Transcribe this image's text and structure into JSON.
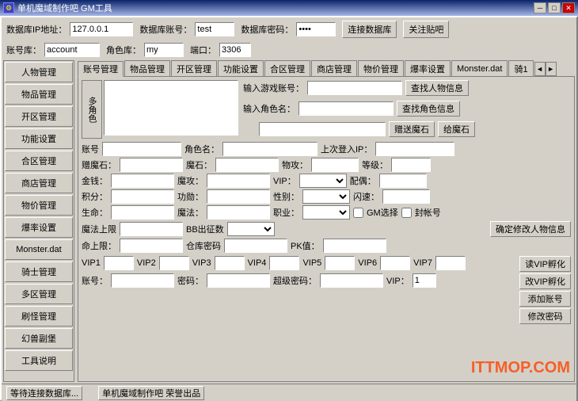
{
  "titleBar": {
    "icon": "⚙",
    "title": "单机魔域制作吧 GM工具",
    "minBtn": "─",
    "maxBtn": "□",
    "closeBtn": "✕"
  },
  "topBar": {
    "dbIpLabel": "数据库IP地址：",
    "dbIpValue": "127.0.0.1",
    "dbAccountLabel": "数据库账号：",
    "dbAccountValue": "test",
    "dbPasswordLabel": "数据库密码：",
    "dbPasswordValue": "****",
    "connectBtn": "连接数据库",
    "focusBtn": "关注贴吧"
  },
  "secondBar": {
    "dbLabel": "账号库：",
    "dbValue": "account",
    "roleDbLabel": "角色库：",
    "roleDbValue": "my",
    "portLabel": "端口：",
    "portValue": "3306"
  },
  "sidebar": {
    "items": [
      "人物管理",
      "物品管理",
      "开区管理",
      "功能设置",
      "合区管理",
      "商店管理",
      "物价管理",
      "爆率设置",
      "Monster.dat",
      "骑士管理",
      "多区管理",
      "刷怪管理",
      "幻兽副堡",
      "工具说明"
    ]
  },
  "tabs": {
    "items": [
      "账号管理",
      "物品管理",
      "开区管理",
      "功能设置",
      "合区管理",
      "商店管理",
      "物价管理",
      "爆率设置",
      "Monster.dat",
      "骑1"
    ],
    "activeIndex": 0,
    "prevBtn": "◄",
    "nextBtn": "►"
  },
  "accountPanel": {
    "multiCharLabel": "多角色",
    "searchGameAcctLabel": "输入游戏账号：",
    "searchRoleLabel": "输入角色名：",
    "findPersonBtn": "查找人物信息",
    "findRoleBtn": "查找角色信息",
    "giftMagicStoneInputLabel": "",
    "giftMagicStoneBtnLeft": "赠送魔石",
    "giftMagicStoneBtnRight": "给魔石",
    "fields": {
      "acctLabel": "账号",
      "roleLabel": "角色名：",
      "lastLoginLabel": "上次登入IP：",
      "giftStoneLabel": "赠魔石：",
      "magicStoneLabel": "魔石：",
      "physAtkLabel": "物攻：",
      "levelLabel": "等级：",
      "goldLabel": "金钱：",
      "magicAtkLabel": "魔攻：",
      "vipLabel": "VIP：",
      "spouseLabel": "配偶：",
      "pointsLabel": "积分：",
      "meritLabel": "功勋：",
      "genderLabel": "性别：",
      "hiddenLabel": "闪速：",
      "hpLabel": "生命：",
      "magicLabel": "魔法：",
      "occupationLabel": "职业：",
      "gmSelectLabel": "GM选择",
      "sealLabel": "封帐号",
      "mpLabel": "魔法上限",
      "bbExitLabel": "BB出征数",
      "hpLimitLabel": "命上限：",
      "warehousePwdLabel": "仓库密码",
      "pkLabel": "PK值：",
      "confirmBtn": "确定修改人物信息"
    },
    "vip": {
      "vip1Label": "VIP1",
      "vip2Label": "VIP2",
      "vip3Label": "VIP3",
      "vip4Label": "VIP4",
      "vip5Label": "VIP5",
      "vip6Label": "VIP6",
      "vip7Label": "VIP7",
      "readVipBtn": "读VIP孵化",
      "changeVipBtn": "改VIP孵化",
      "addAcctBtn": "添加账号",
      "changePwdBtn": "修改密码"
    },
    "bottomRow": {
      "acctLabel": "账号：",
      "pwdLabel": "密码：",
      "superPwdLabel": "超级密码：",
      "vipLabel": "VIP：",
      "vipValue": "1"
    }
  },
  "statusBar": {
    "left": "等待连接数据库...",
    "center": "单机魔域制作吧 荣誉出品"
  },
  "watermark": "ITTMOP.COM"
}
